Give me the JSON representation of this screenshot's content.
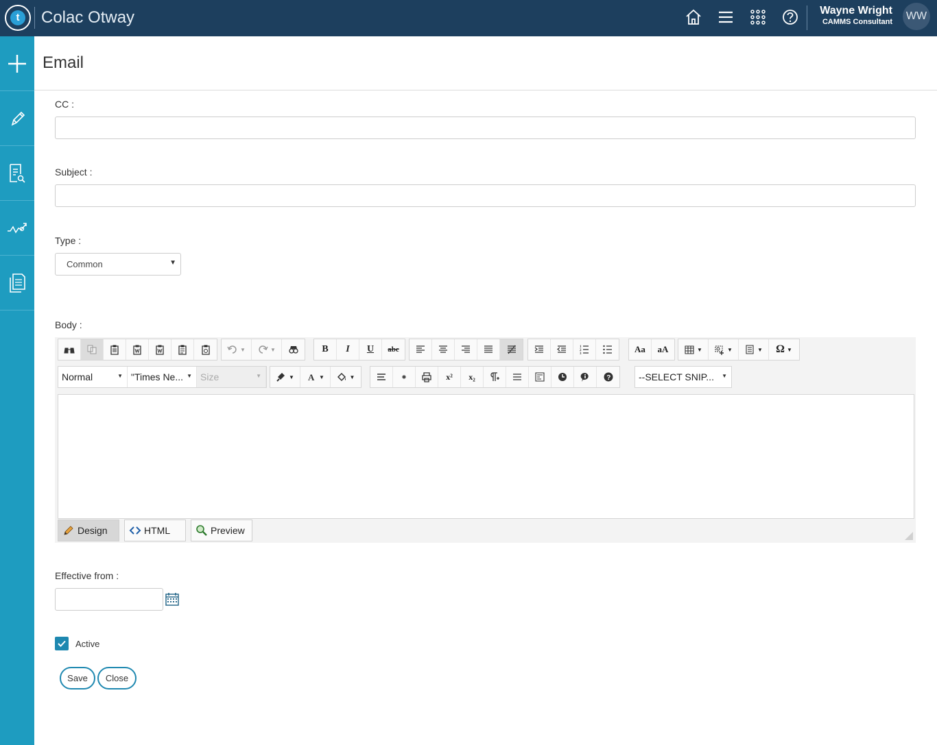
{
  "app": {
    "title": "Colac Otway",
    "logo_letter": "t"
  },
  "topbar": {
    "icons": [
      "home-icon",
      "menu-icon",
      "apps-grid-icon",
      "help-icon"
    ],
    "user_name": "Wayne Wright",
    "user_role": "CAMMS Consultant",
    "avatar_initials": "WW"
  },
  "sidebar": {
    "items": [
      "plus-icon",
      "pencil-icon",
      "document-search-icon",
      "trend-chart-icon",
      "documents-icon"
    ]
  },
  "page": {
    "title": "Email"
  },
  "form": {
    "cc_label": "CC :",
    "cc_value": "",
    "subject_label": "Subject :",
    "subject_value": "",
    "type_label": "Type :",
    "type_value": "Common",
    "body_label": "Body :",
    "effective_label": "Effective from :",
    "effective_value": "",
    "active_label": "Active",
    "active_checked": true,
    "save_label": "Save",
    "close_label": "Close"
  },
  "editor": {
    "format_select": "Normal",
    "font_select": "\"Times Ne...",
    "size_select": "Size",
    "snippet_select": "--SELECT SNIP...",
    "bold": "B",
    "italic": "I",
    "underline": "U",
    "strike": "abc",
    "case_upper": "Aa",
    "case_lower": "aA",
    "special_char": "Ω",
    "superscript": "x²",
    "subscript": "x₂",
    "modes": {
      "design": "Design",
      "html": "HTML",
      "preview": "Preview"
    }
  },
  "colors": {
    "topbar": "#1d3f5e",
    "sidebar": "#1e9cc0",
    "accent": "#1e88b0"
  }
}
